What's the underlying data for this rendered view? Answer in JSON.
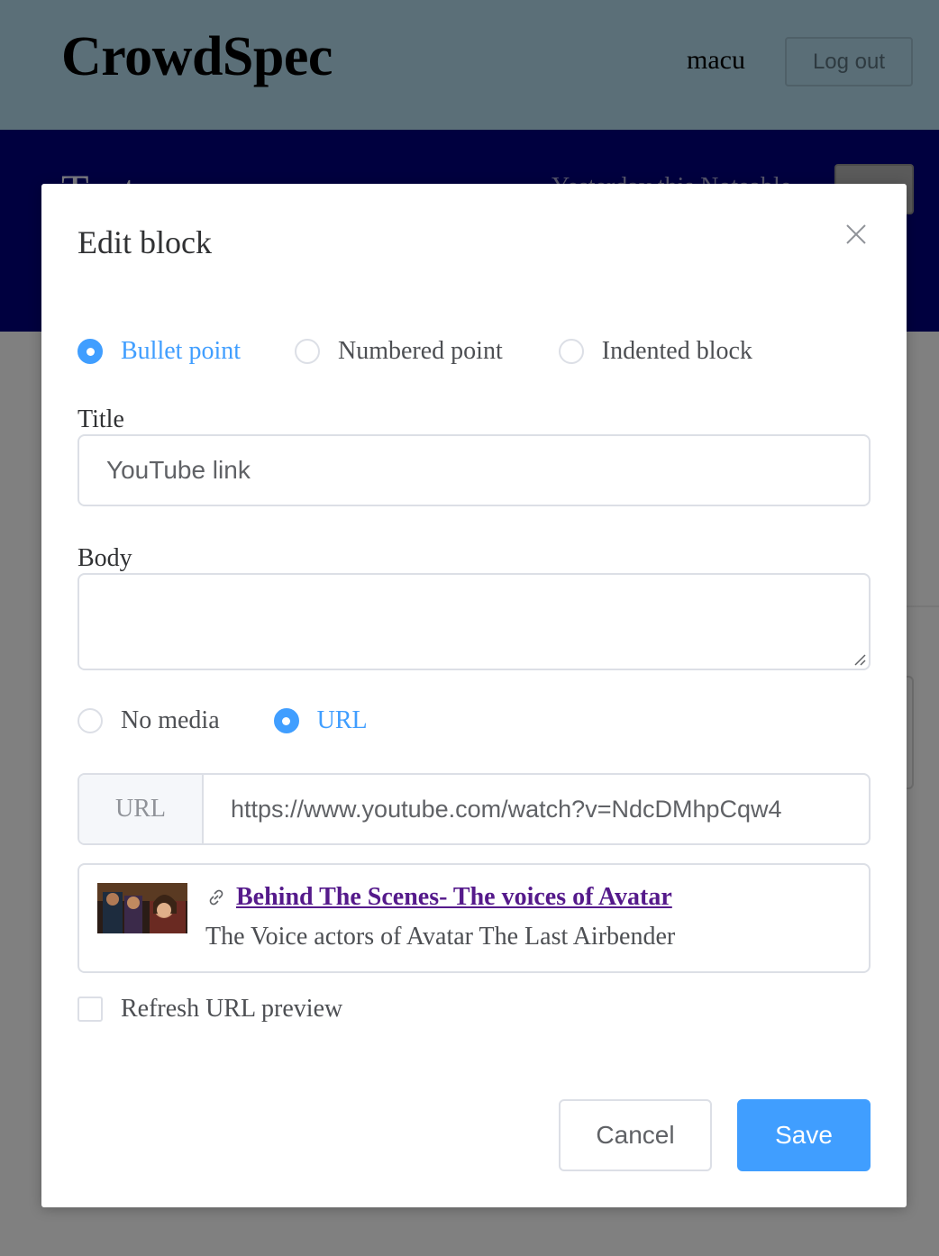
{
  "header": {
    "app_name": "CrowdSpec",
    "username": "macu",
    "logout_label": "Log out"
  },
  "spec": {
    "title": "Test spec",
    "meta": "Yesterday this Noteable"
  },
  "modal": {
    "title": "Edit block",
    "block_types": [
      {
        "label": "Bullet point",
        "checked": true
      },
      {
        "label": "Numbered point",
        "checked": false
      },
      {
        "label": "Indented block",
        "checked": false
      }
    ],
    "title_label": "Title",
    "title_value": "YouTube link",
    "body_label": "Body",
    "body_value": "",
    "media_types": [
      {
        "label": "No media",
        "checked": false
      },
      {
        "label": "URL",
        "checked": true
      }
    ],
    "url_prepend": "URL",
    "url_value": "https://www.youtube.com/watch?v=NdcDMhpCqw4",
    "preview": {
      "title": "Behind The Scenes- The voices of Avatar",
      "description": "The Voice actors of Avatar The Last Airbender"
    },
    "refresh_label": "Refresh URL preview",
    "refresh_checked": false,
    "cancel_label": "Cancel",
    "save_label": "Save"
  },
  "colors": {
    "accent": "#409eff",
    "topbar": "#5b6f78",
    "specbar": "#00003f",
    "overlay_bg": "#808080",
    "visited_link": "#551a8b"
  }
}
